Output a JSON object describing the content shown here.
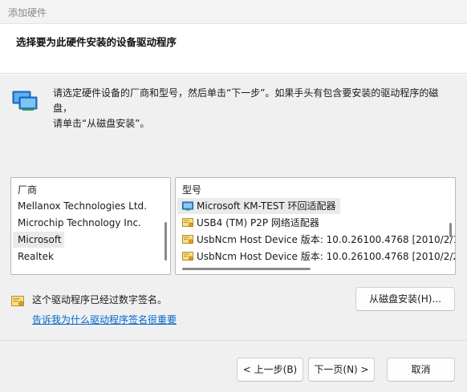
{
  "window": {
    "title": "添加硬件"
  },
  "header": {
    "heading": "选择要为此硬件安装的设备驱动程序"
  },
  "intro": {
    "icon": "network-adapter-icon",
    "line1": "请选定硬件设备的厂商和型号，然后单击“下一步”。如果手头有包含要安装的驱动程序的磁盘，",
    "line2": "请单击“从磁盘安装”。"
  },
  "manufacturer_list": {
    "header": "厂商",
    "items": [
      {
        "label": "Mellanox Technologies Ltd.",
        "selected": false
      },
      {
        "label": "Microchip Technology Inc.",
        "selected": false
      },
      {
        "label": "Microsoft",
        "selected": true
      },
      {
        "label": "Realtek",
        "selected": false
      }
    ]
  },
  "model_list": {
    "header": "型号",
    "items": [
      {
        "label": "Microsoft KM-TEST 环回适配器",
        "icon": "network-adapter-icon",
        "selected": true
      },
      {
        "label": "USB4 (TM) P2P 网络适配器",
        "icon": "certificate-icon",
        "selected": false
      },
      {
        "label": "UsbNcm Host Device 版本: 10.0.26100.4768 [2010/2/1",
        "icon": "certificate-icon",
        "selected": false
      },
      {
        "label": "UsbNcm Host Device 版本: 10.0.26100.4768 [2010/2/2",
        "icon": "certificate-icon",
        "selected": false
      }
    ]
  },
  "signature": {
    "icon": "certificate-icon",
    "text": "这个驱动程序已经过数字签名。",
    "link": "告诉我为什么驱动程序签名很重要"
  },
  "buttons": {
    "have_disk": "从磁盘安装(H)...",
    "back": "< 上一步(B)",
    "next": "下一页(N) >",
    "cancel": "取消"
  },
  "colors": {
    "link": "#0066cc",
    "selection": "#eaeaea",
    "dialog_bg": "#f0f0f0"
  }
}
